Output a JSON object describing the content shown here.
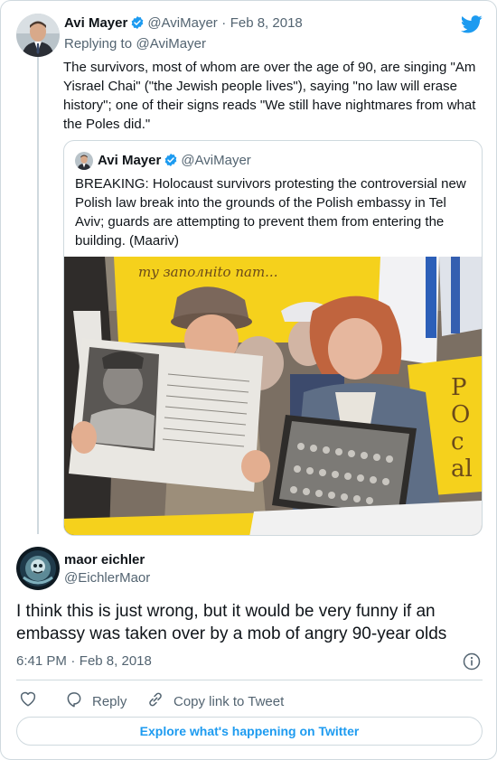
{
  "parent_tweet": {
    "author_name": "Avi Mayer",
    "handle": "@AviMayer",
    "separator": "·",
    "date": "Feb 8, 2018",
    "replying_to_label": "Replying to",
    "replying_to_handle": "@AviMayer",
    "text": "The survivors, most of whom are over the age of 90, are singing \"Am Yisrael Chai\" (\"the Jewish people lives\"), saying \"no law will erase history\"; one of their signs reads \"We still have nightmares from what the Poles did.\""
  },
  "quoted_tweet": {
    "author_name": "Avi Mayer",
    "handle": "@AviMayer",
    "text": "BREAKING: Holocaust survivors protesting the controversial new Polish law break into the grounds of the Polish embassy in Tel Aviv; guards are attempting to prevent them from entering the building. (Maariv)",
    "photo": {
      "sign_left_text": "my заполнito nam...",
      "sign_right_text": "PO cal"
    }
  },
  "main_tweet": {
    "author_name": "maor eichler",
    "handle": "@EichlerMaor",
    "text": "I think this is just wrong, but it would be very funny if an embassy was taken over by a mob of angry 90-year olds",
    "time": "6:41 PM",
    "separator": "·",
    "date": "Feb 8, 2018"
  },
  "actions": {
    "reply_label": "Reply",
    "copy_link_label": "Copy link to Tweet"
  },
  "explore_label": "Explore what's happening on Twitter",
  "colors": {
    "twitter_blue": "#1d9bf0",
    "text_primary": "#0f1419",
    "text_secondary": "#536471",
    "border": "#cfd9de",
    "sign_yellow": "#f5d11c"
  },
  "icons": {
    "brand": "twitter-bird-icon",
    "verified": "verified-badge-icon",
    "info": "info-icon",
    "like": "heart-icon",
    "reply": "reply-bubble-icon",
    "copy_link": "link-icon"
  }
}
